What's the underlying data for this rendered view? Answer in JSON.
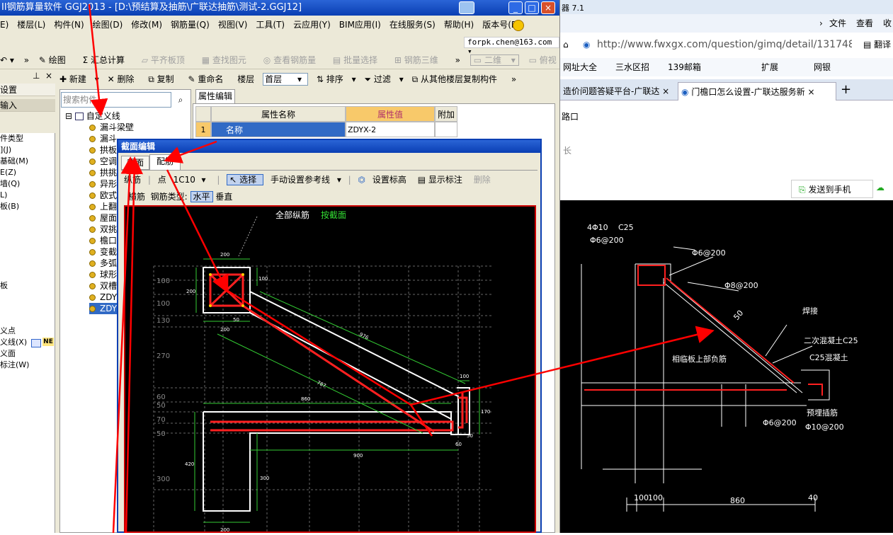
{
  "app": {
    "title": "II钢筋算量软件 GGJ2013 - [D:\\预结算及抽筋\\广联达抽筋\\测试-2.GGJ12]",
    "menu": [
      "E)",
      "楼层(L)",
      "构件(N)",
      "绘图(D)",
      "修改(M)",
      "钢筋量(Q)",
      "视图(V)",
      "工具(T)",
      "云应用(Y)",
      "BIM应用(I)",
      "在线服务(S)",
      "帮助(H)",
      "版本号(B)"
    ],
    "user": "forpk.chen@163.com",
    "toolbar": {
      "draw": "绘图",
      "sum": "汇总计算",
      "flat_top": "平齐板顶",
      "find_element": "查找图元",
      "view_rebar": "查看钢筋量",
      "batch_select": "批量选择",
      "rebar_3d": "钢筋三维",
      "view_2d": "二维",
      "view_mode": "俯视"
    },
    "left_panel": {
      "settings": "设置",
      "input": "输入",
      "items": [
        "件类型",
        "](J)",
        "基础(M)",
        "E(Z)",
        "墙(Q)",
        "L)",
        "板(B)"
      ],
      "item_misc": "板",
      "bottom_items": [
        "义点",
        "义线(X)",
        "义面",
        "标注(W)"
      ],
      "badge": "NE"
    },
    "tree_toolbar": {
      "new": "新建",
      "delete": "删除",
      "copy": "复制",
      "rename": "重命名",
      "floor_label": "楼层",
      "floor_value": "首层",
      "sort": "排序",
      "filter": "过滤",
      "copy_from": "从其他楼层复制构件"
    },
    "search_placeholder": "搜索构件",
    "tree": {
      "root": "自定义线",
      "items": [
        "漏斗梁壁",
        "漏斗",
        "拱板",
        "空调",
        "拱挑",
        "异形",
        "欧式",
        "上翻",
        "屋面",
        "双挑",
        "檐口",
        "变截",
        "多弧",
        "球形",
        "双槽",
        "ZDY",
        "ZDY"
      ]
    },
    "props": {
      "tab": "属性编辑",
      "col_name": "属性名称",
      "col_value": "属性值",
      "col_extra": "附加",
      "row_no": "1",
      "row_name": "名称",
      "row_value": "ZDYX-2"
    }
  },
  "dialog": {
    "title": "截面编辑",
    "tab_section": "截面",
    "tab_rebar": "配筋",
    "long_bar_label": "纵筋",
    "point_label": "点",
    "bar_spec": "1C10",
    "select": "选择",
    "ref_line": "手动设置参考线",
    "set_elevation": "设置标高",
    "show_annot": "显示标注",
    "delete": "删除",
    "cross_bar": "横筋",
    "rebar_type": "钢筋类型:",
    "horizontal": "水平",
    "vertical": "垂直",
    "canvas_label_all": "全部纵筋",
    "canvas_label_section": "按截面",
    "dims": {
      "top_w": "200",
      "top_h": "200",
      "d100a": "100",
      "d976": "976",
      "d787": "787",
      "d100b": "100",
      "d170": "170",
      "d860": "860",
      "d50": "50",
      "d60": "60",
      "d900": "900",
      "d420": "420",
      "d300": "300",
      "d200b": "200",
      "d50b": "50",
      "d200c": "200"
    },
    "grid_labels": [
      "100",
      "100",
      "130",
      "270",
      "60",
      "50",
      "70",
      "50",
      "300"
    ]
  },
  "browser": {
    "tab_top": "器 7.1",
    "menu": [
      "文件",
      "查看",
      "收"
    ],
    "url": "http://www.fwxgx.com/question/gimq/detail/1317481.html",
    "translate": "翻译",
    "favorites": [
      "网址大全",
      "三水区招",
      "139邮箱",
      "扩展",
      "网银"
    ],
    "tab1": "造价问题答疑平台-广联达",
    "tab2": "门檐口怎么设置-广联达服务新",
    "page_text1": "路口",
    "page_text2": "长",
    "send_phone": "发送到手机"
  },
  "cad": {
    "labels": {
      "top_bars": "4Φ10",
      "c25": "C25",
      "stirrup1": "Φ6@200",
      "d1": "Φ6@200",
      "d2": "Φ8@200",
      "d50": "50",
      "weld": "焊接",
      "conc2": "二次混凝土C25",
      "conc": "C25混凝土",
      "upper": "相临板上部负筋",
      "d6": "Φ6@200",
      "plant": "预埋插筋",
      "d10": "Φ10@200",
      "b100a": "100",
      "b100b": "100",
      "b860": "860",
      "b40": "40"
    }
  },
  "colors": {
    "arrow": "#ff0000",
    "xp_blue": "#0a3fb3",
    "rebar": "#ff0000",
    "cad_line": "#ffffff",
    "dim_green": "#33cc33"
  }
}
